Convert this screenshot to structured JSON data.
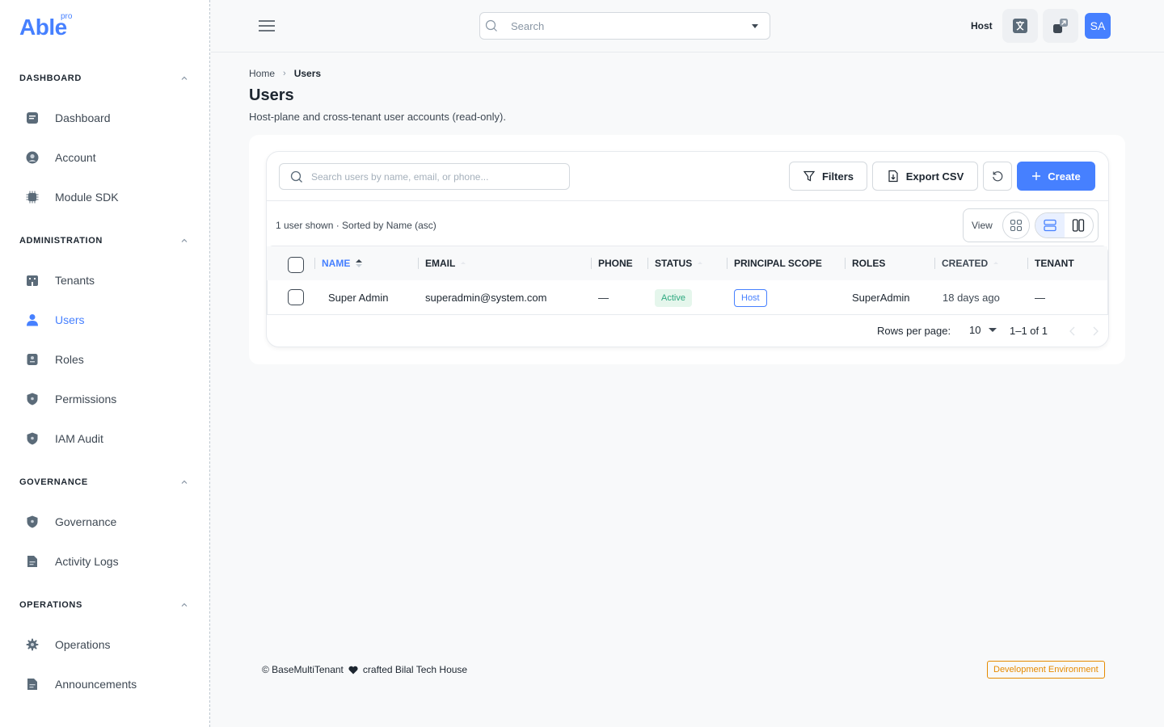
{
  "brand": {
    "name": "Able",
    "badge": "pro"
  },
  "sidebar": {
    "groups": [
      {
        "title": "DASHBOARD",
        "items": [
          {
            "label": "Dashboard",
            "icon": "dashboard-icon"
          },
          {
            "label": "Account",
            "icon": "account-icon"
          },
          {
            "label": "Module SDK",
            "icon": "chip-icon"
          }
        ]
      },
      {
        "title": "ADMINISTRATION",
        "items": [
          {
            "label": "Tenants",
            "icon": "building-icon"
          },
          {
            "label": "Users",
            "icon": "user-icon",
            "active": true
          },
          {
            "label": "Roles",
            "icon": "id-card-icon"
          },
          {
            "label": "Permissions",
            "icon": "shield-icon"
          },
          {
            "label": "IAM Audit",
            "icon": "shield-icon"
          }
        ]
      },
      {
        "title": "GOVERNANCE",
        "items": [
          {
            "label": "Governance",
            "icon": "shield-icon"
          },
          {
            "label": "Activity Logs",
            "icon": "document-icon"
          }
        ]
      },
      {
        "title": "OPERATIONS",
        "items": [
          {
            "label": "Operations",
            "icon": "gear-icon"
          },
          {
            "label": "Announcements",
            "icon": "document-icon"
          }
        ]
      }
    ]
  },
  "header": {
    "search_placeholder": "Search",
    "host_label": "Host",
    "avatar_initials": "SA"
  },
  "breadcrumb": {
    "home": "Home",
    "separator": "›",
    "current": "Users"
  },
  "page": {
    "title": "Users",
    "subtitle": "Host-plane and cross-tenant user accounts (read-only)."
  },
  "toolbar": {
    "search_placeholder": "Search users by name, email, or phone...",
    "filters_label": "Filters",
    "export_label": "Export CSV",
    "create_label": "Create"
  },
  "summary": "1 user shown · Sorted by Name (asc)",
  "view": {
    "label": "View"
  },
  "table": {
    "columns": [
      "NAME",
      "EMAIL",
      "PHONE",
      "STATUS",
      "PRINCIPAL SCOPE",
      "ROLES",
      "CREATED",
      "TENANT"
    ],
    "rows": [
      {
        "name": "Super Admin",
        "email": "superadmin@system.com",
        "phone": "—",
        "status": "Active",
        "scope": "Host",
        "roles": "SuperAdmin",
        "created": "18 days ago",
        "tenant": "—"
      }
    ]
  },
  "pagination": {
    "rows_per_page_label": "Rows per page:",
    "rows_per_page": "10",
    "range": "1–1 of 1"
  },
  "footer": {
    "copyright": "© BaseMultiTenant",
    "crafted": "crafted Bilal Tech House",
    "environment": "Development Environment"
  },
  "colors": {
    "accent": "#4680ff",
    "success": "#2ca87f",
    "warning": "#e58a00"
  }
}
